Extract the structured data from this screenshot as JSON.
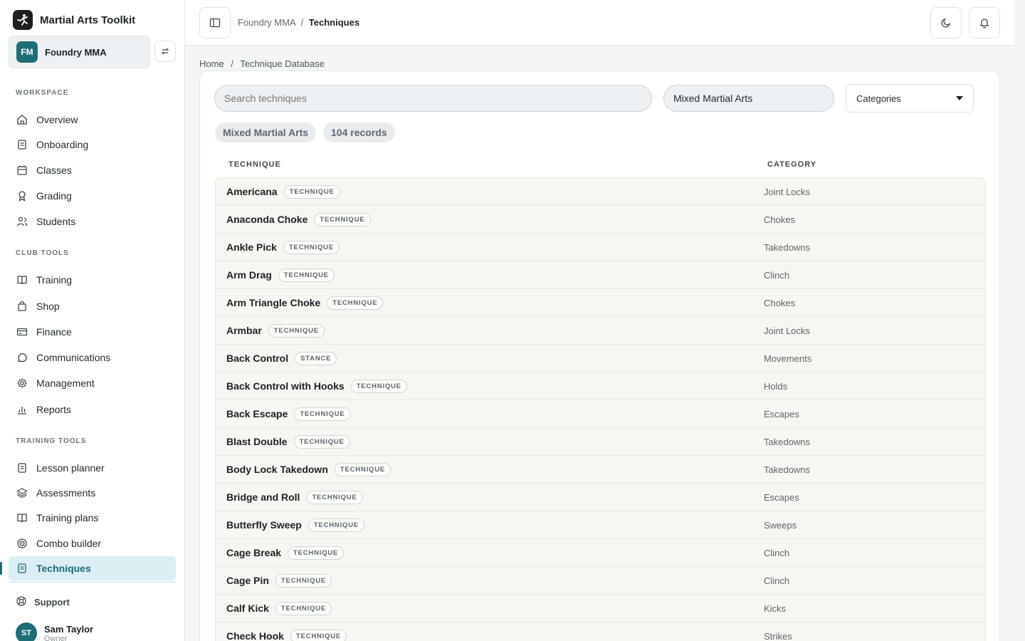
{
  "app": {
    "title": "Martial Arts Toolkit"
  },
  "org": {
    "initials": "FM",
    "name": "Foundry MMA"
  },
  "sections": {
    "workspace": "WORKSPACE",
    "club_tools": "CLUB TOOLS",
    "training_tools": "TRAINING TOOLS"
  },
  "nav": {
    "overview": "Overview",
    "onboarding": "Onboarding",
    "classes": "Classes",
    "grading": "Grading",
    "students": "Students",
    "training": "Training",
    "shop": "Shop",
    "finance": "Finance",
    "communications": "Communications",
    "management": "Management",
    "reports": "Reports",
    "lesson_planner": "Lesson planner",
    "assessments": "Assessments",
    "training_plans": "Training plans",
    "combo_builder": "Combo builder",
    "techniques": "Techniques"
  },
  "support": "Support",
  "user": {
    "initials": "ST",
    "name": "Sam Taylor",
    "role": "Owner"
  },
  "topbar": {
    "crumb_org": "Foundry MMA",
    "separator": "/",
    "crumb_page": "Techniques"
  },
  "breadcrumb": {
    "home": "Home",
    "separator": "/",
    "current": "Technique Database"
  },
  "filters": {
    "search_placeholder": "Search techniques",
    "art_value": "Mixed Martial Arts",
    "category_value": "Categories"
  },
  "chips": {
    "art": "Mixed Martial Arts",
    "records": "104 records"
  },
  "table": {
    "headers": {
      "technique": "TECHNIQUE",
      "category": "CATEGORY"
    },
    "rows": [
      {
        "name": "Americana",
        "badge": "TECHNIQUE",
        "category": "Joint Locks"
      },
      {
        "name": "Anaconda Choke",
        "badge": "TECHNIQUE",
        "category": "Chokes"
      },
      {
        "name": "Ankle Pick",
        "badge": "TECHNIQUE",
        "category": "Takedowns"
      },
      {
        "name": "Arm Drag",
        "badge": "TECHNIQUE",
        "category": "Clinch"
      },
      {
        "name": "Arm Triangle Choke",
        "badge": "TECHNIQUE",
        "category": "Chokes"
      },
      {
        "name": "Armbar",
        "badge": "TECHNIQUE",
        "category": "Joint Locks"
      },
      {
        "name": "Back Control",
        "badge": "STANCE",
        "category": "Movements"
      },
      {
        "name": "Back Control with Hooks",
        "badge": "TECHNIQUE",
        "category": "Holds"
      },
      {
        "name": "Back Escape",
        "badge": "TECHNIQUE",
        "category": "Escapes"
      },
      {
        "name": "Blast Double",
        "badge": "TECHNIQUE",
        "category": "Takedowns"
      },
      {
        "name": "Body Lock Takedown",
        "badge": "TECHNIQUE",
        "category": "Takedowns"
      },
      {
        "name": "Bridge and Roll",
        "badge": "TECHNIQUE",
        "category": "Escapes"
      },
      {
        "name": "Butterfly Sweep",
        "badge": "TECHNIQUE",
        "category": "Sweeps"
      },
      {
        "name": "Cage Break",
        "badge": "TECHNIQUE",
        "category": "Clinch"
      },
      {
        "name": "Cage Pin",
        "badge": "TECHNIQUE",
        "category": "Clinch"
      },
      {
        "name": "Calf Kick",
        "badge": "TECHNIQUE",
        "category": "Kicks"
      },
      {
        "name": "Check Hook",
        "badge": "TECHNIQUE",
        "category": "Strikes"
      }
    ]
  },
  "colors": {
    "accent": "#1d6a7a",
    "avatar": "#1e6e77",
    "row_bg": "#f8f6f1"
  }
}
